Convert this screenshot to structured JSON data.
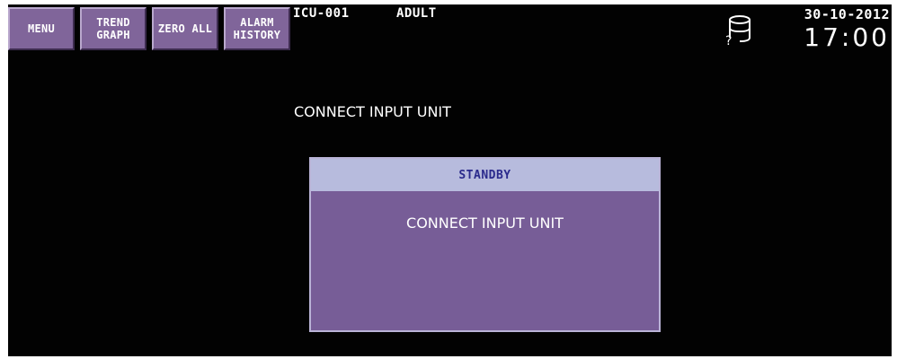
{
  "softkeys": {
    "menu": "MENU",
    "trend_graph": [
      "TREND",
      "GRAPH"
    ],
    "zero_all": "ZERO ALL",
    "alarm_history": [
      "ALARM",
      "HISTORY"
    ]
  },
  "header": {
    "bed_id": "ICU-001",
    "patient_type": "ADULT",
    "date": "30-10-2012",
    "time": "17:00",
    "status_icon": "database-unknown-icon"
  },
  "main": {
    "message": "CONNECT INPUT UNIT"
  },
  "dialog": {
    "title": "STANDBY",
    "message": "CONNECT INPUT UNIT"
  },
  "colors": {
    "softkey": "#80659a",
    "dialog_body": "#775d97",
    "dialog_header": "#b7bbdd",
    "screen_bg": "#020202"
  }
}
